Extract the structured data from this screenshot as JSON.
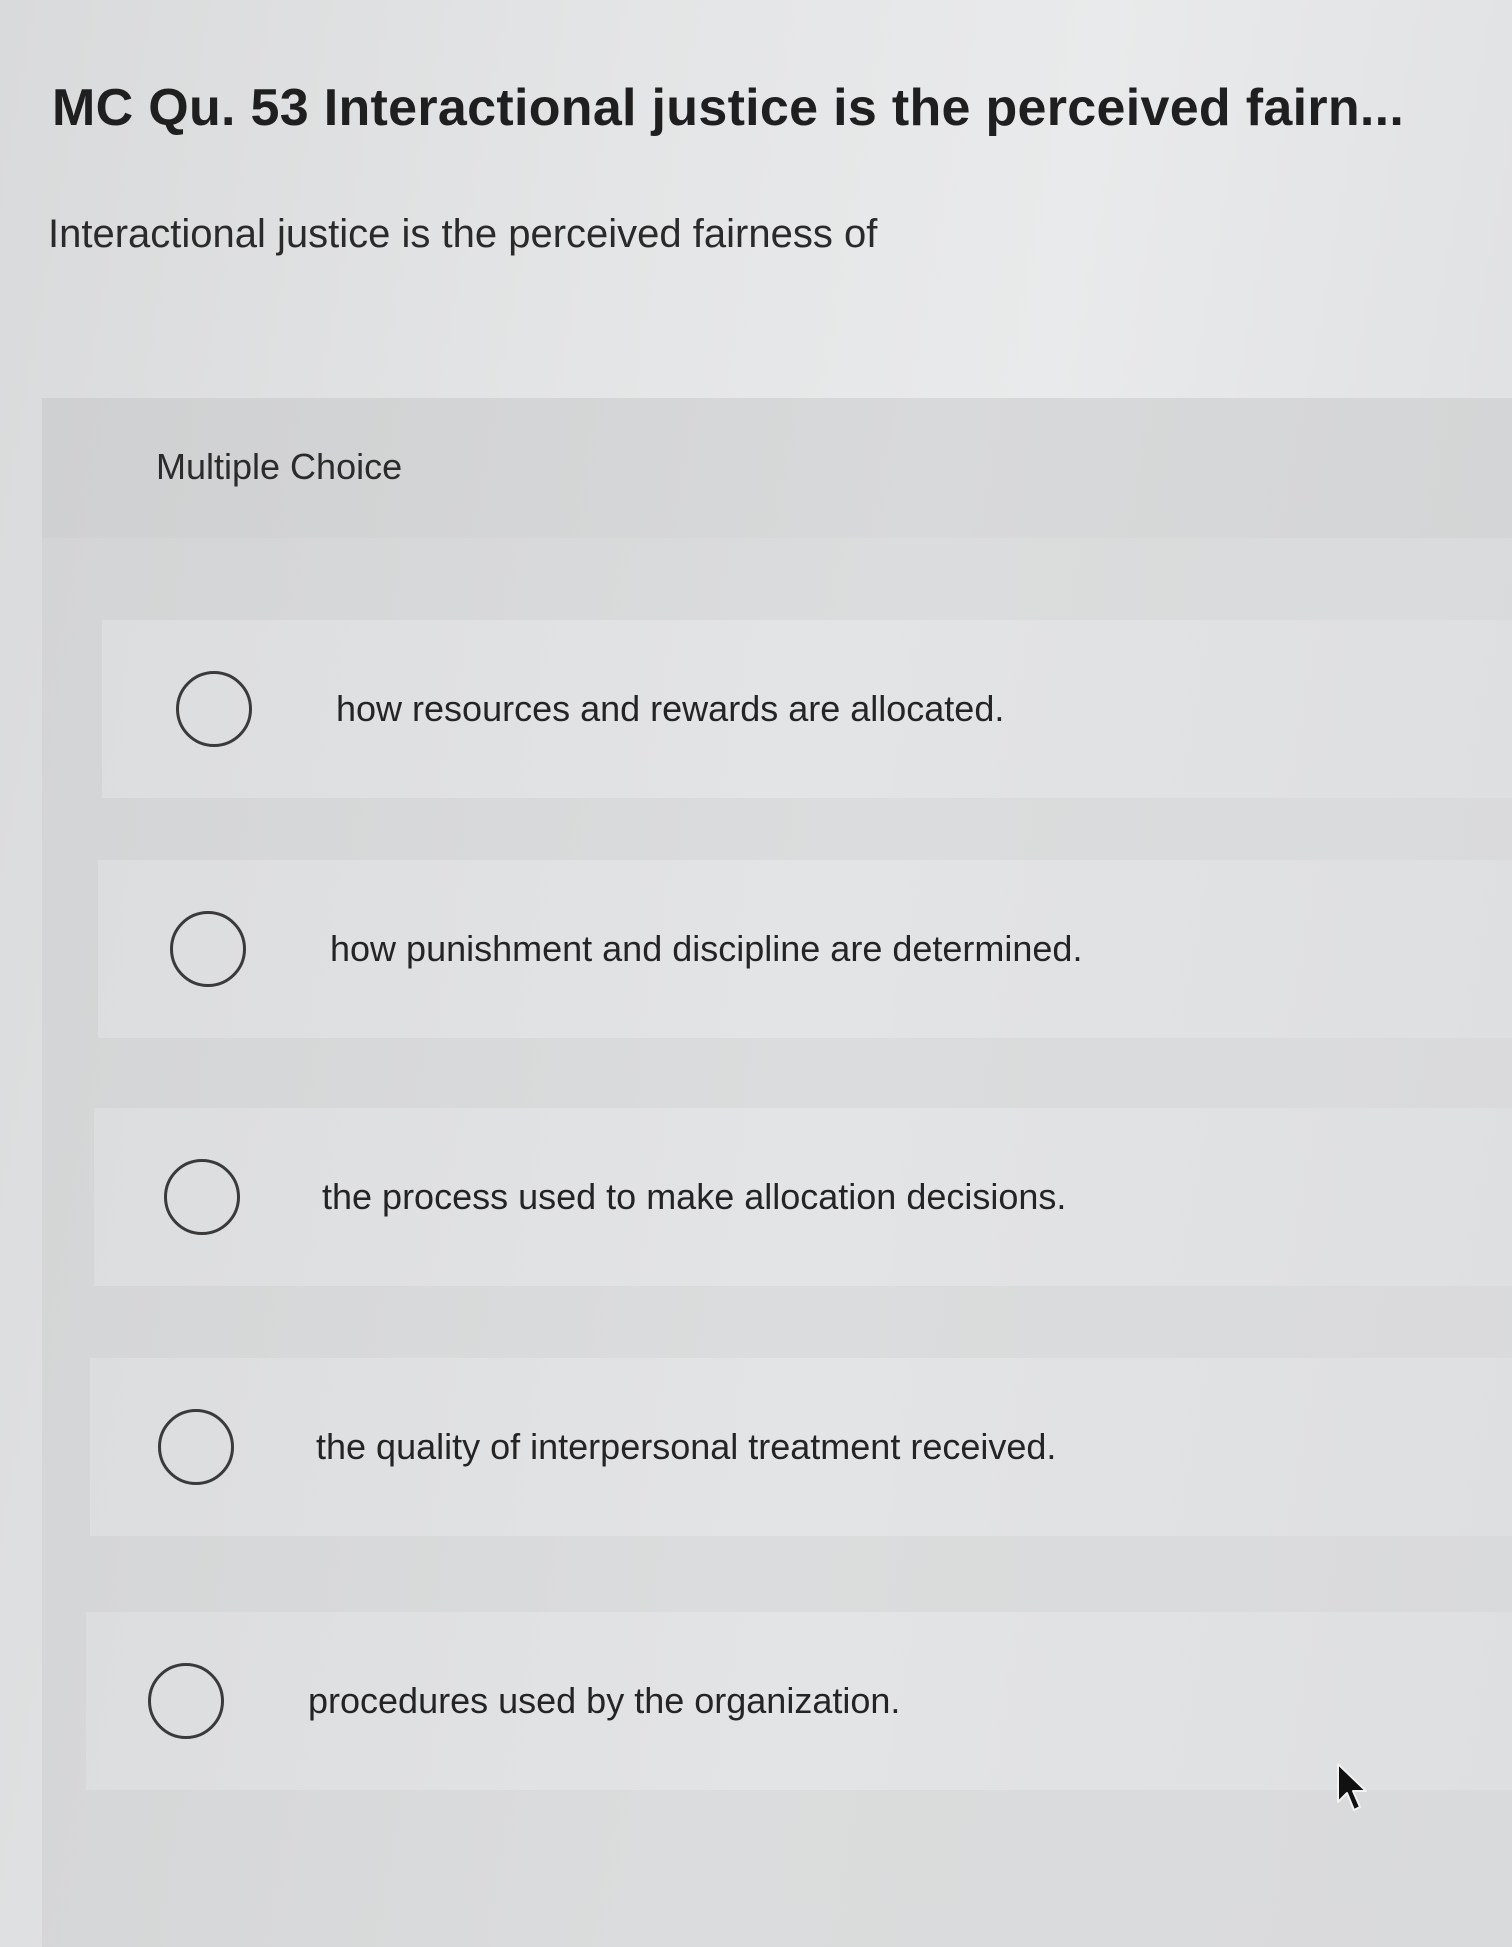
{
  "question": {
    "title": "MC Qu. 53 Interactional justice is the perceived fairn...",
    "prompt": "Interactional justice is the perceived fairness of"
  },
  "multiple_choice": {
    "label": "Multiple Choice",
    "options": [
      {
        "text": "how resources and rewards are allocated.",
        "selected": false
      },
      {
        "text": "how punishment and discipline are determined.",
        "selected": false
      },
      {
        "text": "the process used to make allocation decisions.",
        "selected": false
      },
      {
        "text": "the quality of interpersonal treatment received.",
        "selected": false
      },
      {
        "text": "procedures used by the organization.",
        "selected": false
      }
    ]
  },
  "icons": {
    "radio": "radio-unselected-icon",
    "cursor": "mouse-pointer-icon"
  },
  "colors": {
    "background": "#e4e5e6",
    "panel": "#d8d9da",
    "option_row": "#e2e3e5",
    "text": "#262626",
    "radio_border": "#3a3a3a"
  }
}
